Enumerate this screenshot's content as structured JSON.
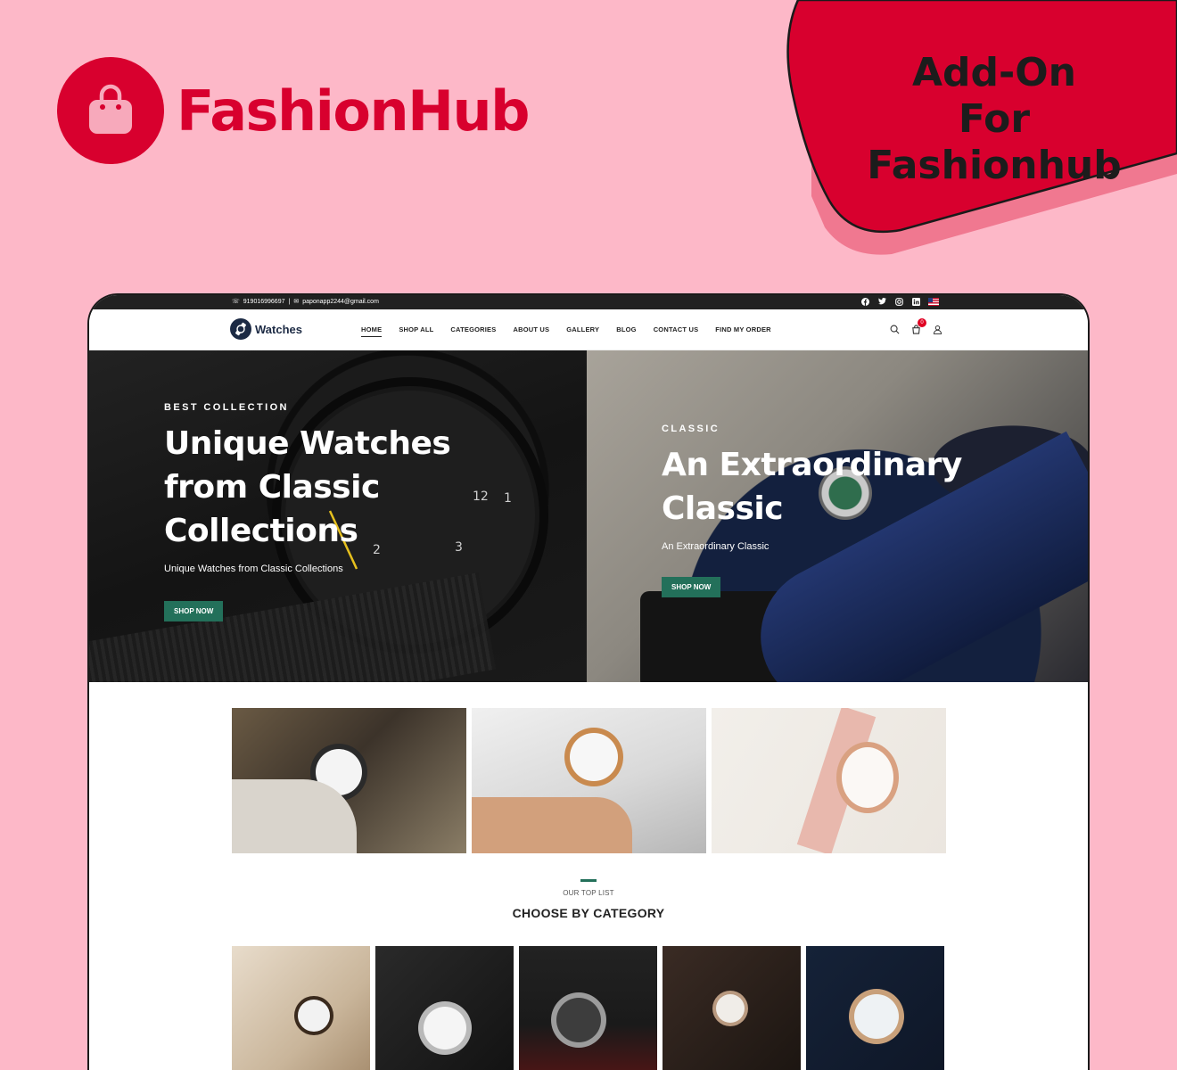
{
  "brand": {
    "name": "FashionHub",
    "color": "#d8002e",
    "icon": "shopping-bag-icon"
  },
  "badge": {
    "line1": "Add-On",
    "line2": "For Fashionhub",
    "color": "#d8002e"
  },
  "site": {
    "topbar": {
      "phone": "919016996697",
      "separator": "|",
      "email": "paponapp2244@gmail.com",
      "social_icons": [
        "facebook-icon",
        "twitter-icon",
        "instagram-icon",
        "linkedin-icon",
        "us-flag-icon"
      ]
    },
    "logo_text": "Watches",
    "menu": [
      "HOME",
      "SHOP ALL",
      "CATEGORIES",
      "ABOUT US",
      "GALLERY",
      "BLOG",
      "CONTACT US",
      "FIND MY ORDER"
    ],
    "active_menu": "HOME",
    "cart_count": "0",
    "hero_left": {
      "kicker": "BEST COLLECTION",
      "title_line1": "Unique Watches",
      "title_line2": "from Classic",
      "title_line3": "Collections",
      "subtitle": "Unique Watches from Classic Collections",
      "button": "SHOP NOW"
    },
    "hero_right": {
      "kicker": "CLASSIC",
      "title_line1": "An Extraordinary",
      "title_line2": "Classic",
      "subtitle": "An Extraordinary Classic",
      "button": "SHOP NOW"
    },
    "section": {
      "kicker": "OUR TOP LIST",
      "title": "CHOOSE BY CATEGORY"
    },
    "accent": "#23705a"
  }
}
